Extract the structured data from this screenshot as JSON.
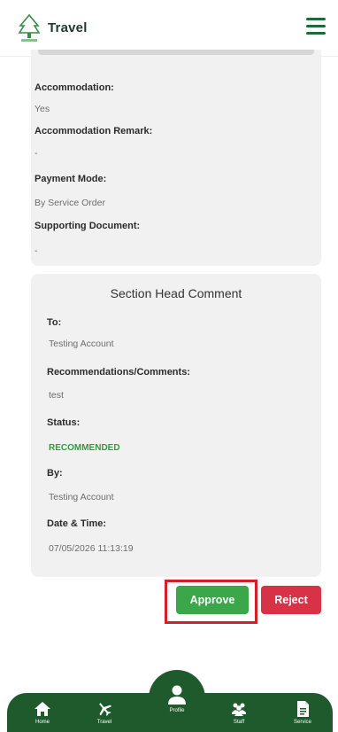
{
  "header": {
    "title": "Travel",
    "menu_icon": "hamburger-menu-icon",
    "logo": "travel-logo"
  },
  "details": {
    "fields": [
      {
        "label": "Accommodation:",
        "value": "Yes"
      },
      {
        "label": "Accommodation Remark:",
        "value": "-"
      },
      {
        "label": "Payment Mode:",
        "value": "By Service Order"
      },
      {
        "label": "Supporting Document:",
        "value": "-"
      }
    ]
  },
  "section_head": {
    "title": "Section Head Comment",
    "fields": [
      {
        "label": "To:",
        "value": "Testing Account"
      },
      {
        "label": "Recommendations/Comments:",
        "value": "test"
      },
      {
        "label": "Status:",
        "value": "RECOMMENDED"
      },
      {
        "label": "By:",
        "value": "Testing Account"
      },
      {
        "label": "Date & Time:",
        "value": "07/05/2026 11:13:19"
      }
    ]
  },
  "actions": {
    "approve": "Approve",
    "reject": "Reject"
  },
  "colors": {
    "brand_green": "#1f5a2d",
    "approve": "#3aa74b",
    "reject": "#d83246",
    "status_green": "#2e9d3f",
    "highlight": "#d41f2a"
  },
  "nav": {
    "items": [
      {
        "label": "Home",
        "icon": "home-icon"
      },
      {
        "label": "Travel",
        "icon": "airplane-icon"
      },
      {
        "label": "Profile",
        "icon": "profile-icon"
      },
      {
        "label": "Staff",
        "icon": "staff-icon"
      },
      {
        "label": "Service",
        "icon": "document-icon"
      }
    ]
  }
}
